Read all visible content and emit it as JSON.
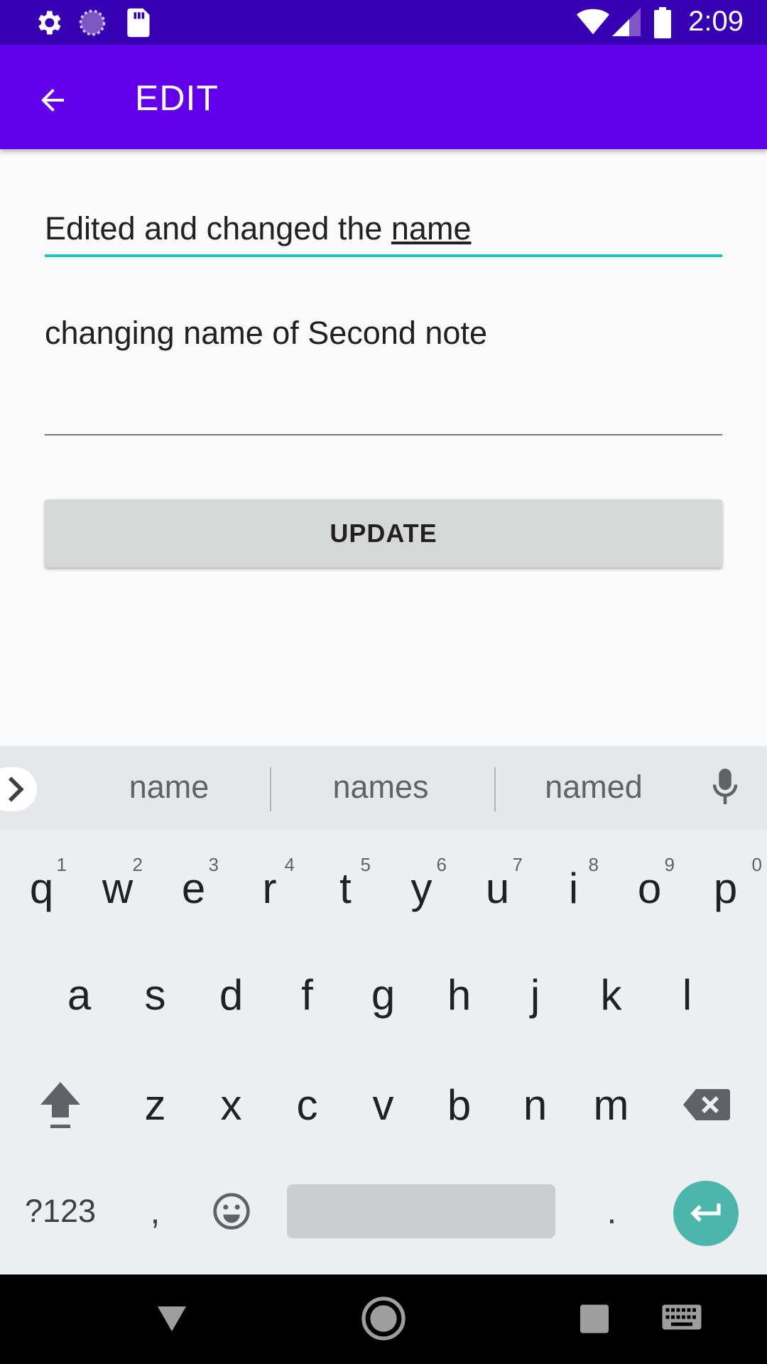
{
  "status_bar": {
    "time": "2:09",
    "icons": [
      "gear-icon",
      "sync-icon",
      "sd-card-icon",
      "wifi-icon",
      "signal-icon",
      "battery-icon"
    ]
  },
  "app_bar": {
    "title": "EDIT",
    "back_icon": "arrow-back-icon"
  },
  "form": {
    "title_value_prefix": "Edited and changed the ",
    "title_value_suggest": "name",
    "body_value": "changing name of Second note",
    "update_label": "UPDATE"
  },
  "keyboard": {
    "suggestions": [
      "name",
      "names",
      "named"
    ],
    "row1": [
      "q",
      "w",
      "e",
      "r",
      "t",
      "y",
      "u",
      "i",
      "o",
      "p"
    ],
    "row1_hints": [
      "1",
      "2",
      "3",
      "4",
      "5",
      "6",
      "7",
      "8",
      "9",
      "0"
    ],
    "row2": [
      "a",
      "s",
      "d",
      "f",
      "g",
      "h",
      "j",
      "k",
      "l"
    ],
    "row3": [
      "z",
      "x",
      "c",
      "v",
      "b",
      "n",
      "m"
    ],
    "symbols_label": "?123",
    "comma_label": ",",
    "period_label": ".",
    "accent_color": "#4db6ac"
  },
  "colors": {
    "status_bar": "#3700b3",
    "app_bar": "#6200ee",
    "focus_underline": "#1dc6b8"
  }
}
